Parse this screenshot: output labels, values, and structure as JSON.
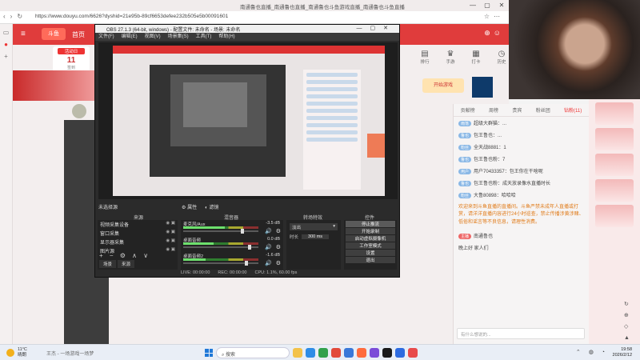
{
  "browser": {
    "tab_title": "南通鲁也直播_南通鲁也直播_南通鲁也斗鱼游戏直播_南通鲁也斗鱼直播",
    "url": "https://www.douyu.com/6626?dyshid=21e95b-89cf6653defee232b505e5b00091601",
    "window_controls": [
      "—",
      "▢",
      "✕"
    ]
  },
  "site": {
    "nav_home": "首页",
    "top_icons": [
      {
        "icon": "chart-icon",
        "label": "排行"
      },
      {
        "icon": "trophy-icon",
        "label": "手游"
      },
      {
        "icon": "calendar-icon",
        "label": "打卡"
      },
      {
        "icon": "record-icon",
        "label": "历史"
      },
      {
        "icon": "more-icon",
        "label": "更多"
      }
    ],
    "promo": {
      "tag": "活动日",
      "day": "11",
      "sub": "签到"
    },
    "right_banner": "开始游戏",
    "chat_tabs": [
      "贡献榜",
      "周榜",
      "贵宾",
      "粉丝团",
      "钻粉(11)"
    ],
    "chat_lines": [
      {
        "badge": "雨落",
        "text": "超级大群猫：..."
      },
      {
        "badge": "鲁也",
        "text": "包王鲁也：..."
      },
      {
        "badge": "粉丝",
        "text": "全天战8881：1"
      },
      {
        "badge": "鲁也",
        "text": "包王鲁也粉：7"
      },
      {
        "badge": "用户",
        "text": "用户70433357：包王你在干啥呢"
      },
      {
        "badge": "鲁也",
        "text": "包王鲁也粉：成天放录像水直播时长"
      },
      {
        "badge": "粉丝",
        "text": "大鲁80898：哈哈哈"
      }
    ],
    "system_notice": "欢迎来到斗鱼直播的直播间。斗鱼严禁未成年人直播或打赏，请洋洋直播内容进行24小时巡查，禁止传播涉黄涉赌、低俗和谣言等不良信息，请理性消费。",
    "chat_footer_user": "南通鲁也",
    "chat_footer_msg": "晚上好 家人们",
    "chat_input_placeholder": "有什么想说的..."
  },
  "obs": {
    "title": "OBS 27.1.3 (64-bit, windows) - 配置文件: 未命名 - 场景: 未命名",
    "menu": [
      "文件(F)",
      "编辑(E)",
      "视图(V)",
      "场景集(S)",
      "工具(T)",
      "帮助(H)"
    ],
    "scene_label": "未选择源",
    "scene_props": "属性",
    "scene_filters": "滤镜",
    "panel_heads": [
      "来源",
      "混音器",
      "转场特效",
      "控件"
    ],
    "sources": [
      {
        "name": "视频采集设备"
      },
      {
        "name": "窗口采集"
      },
      {
        "name": "显示器采集"
      },
      {
        "name": "图片源"
      }
    ],
    "source_tabs": [
      "场景",
      "来源"
    ],
    "mixer": [
      {
        "name": "麦克风/Aux",
        "db": "-3.5 dB",
        "level": 0.55,
        "volume": 0.8
      },
      {
        "name": "桌面音频",
        "db": "0.0 dB",
        "level": 0.4,
        "volume": 0.9
      },
      {
        "name": "桌面音频2",
        "db": "-1.6 dB",
        "level": 0.3,
        "volume": 0.85
      }
    ],
    "transition": {
      "type": "淡出",
      "duration_label": "时长",
      "duration": "300 ms"
    },
    "controls": [
      "停止推流",
      "开始录制",
      "启动虚拟摄像机",
      "工作室模式",
      "设置",
      "退出"
    ],
    "status": [
      "LIVE: 00:00:00",
      "REC: 00:00:00",
      "CPU: 1.1%, 60.00 fps"
    ]
  },
  "taskbar": {
    "weather_temp": "11°C",
    "weather_desc": "晴朗",
    "song": "王杰 - 一场游戏一场梦",
    "search_placeholder": "搜索",
    "time": "19:58",
    "date": "2026/2/12",
    "apps": [
      "#f3c24a",
      "#2e8ce6",
      "#31a14d",
      "#e24a3b",
      "#3a78d8",
      "#ff6b3d",
      "#7a4bd8",
      "#1a1a1a",
      "#2d6be0",
      "#e84b4b"
    ]
  }
}
